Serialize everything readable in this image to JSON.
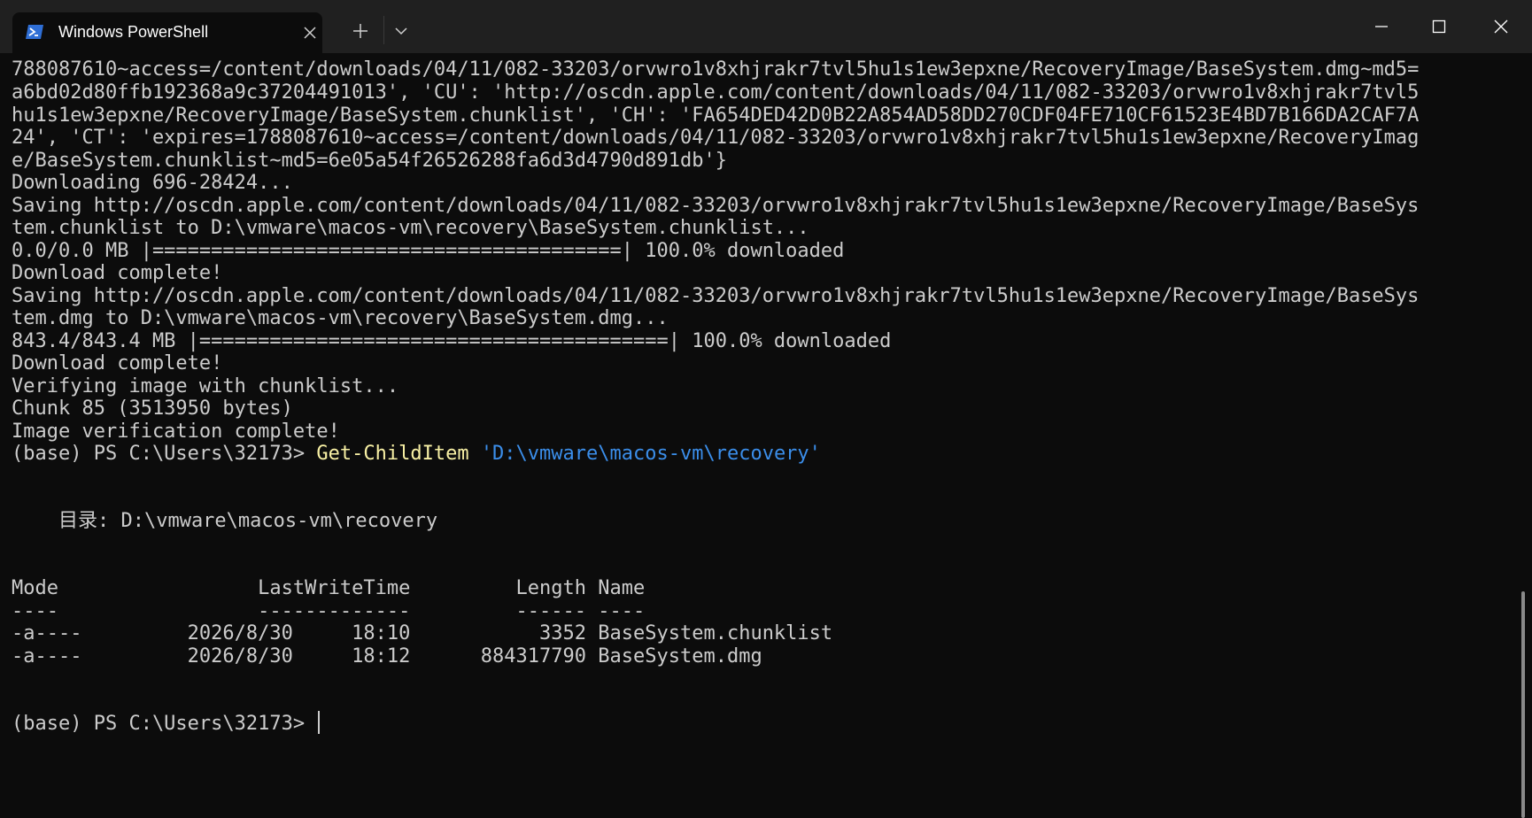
{
  "tab": {
    "title": "Windows PowerShell",
    "icon": "powershell-icon"
  },
  "terminal": {
    "wrapped_lines": [
      "788087610~access=/content/downloads/04/11/082-33203/orvwro1v8xhjrakr7tvl5hu1s1ew3epxne/RecoveryImage/BaseSystem.dmg~md5=",
      "a6bd02d80ffb192368a9c37204491013', 'CU': 'http://oscdn.apple.com/content/downloads/04/11/082-33203/orvwro1v8xhjrakr7tvl5",
      "hu1s1ew3epxne/RecoveryImage/BaseSystem.chunklist', 'CH': 'FA654DED42D0B22A854AD58DD270CDF04FE710CF61523E4BD7B166DA2CAF7A",
      "24', 'CT': 'expires=1788087610~access=/content/downloads/04/11/082-33203/orvwro1v8xhjrakr7tvl5hu1s1ew3epxne/RecoveryImag",
      "e/BaseSystem.chunklist~md5=6e05a54f26526288fa6d3d4790d891db'}",
      "Downloading 696-28424...",
      "Saving http://oscdn.apple.com/content/downloads/04/11/082-33203/orvwro1v8xhjrakr7tvl5hu1s1ew3epxne/RecoveryImage/BaseSys",
      "tem.chunklist to D:\\vmware\\macos-vm\\recovery\\BaseSystem.chunklist...",
      "0.0/0.0 MB |========================================| 100.0% downloaded",
      "Download complete!",
      "Saving http://oscdn.apple.com/content/downloads/04/11/082-33203/orvwro1v8xhjrakr7tvl5hu1s1ew3epxne/RecoveryImage/BaseSys",
      "tem.dmg to D:\\vmware\\macos-vm\\recovery\\BaseSystem.dmg...",
      "843.4/843.4 MB |========================================| 100.0% downloaded",
      "Download complete!",
      "Verifying image with chunklist...",
      "Chunk 85 (3513950 bytes)",
      "Image verification complete!"
    ],
    "prompt": "(base) PS C:\\Users\\32173> ",
    "command": "Get-ChildItem",
    "command_arg": "'D:\\vmware\\macos-vm\\recovery'",
    "directory_line": "    目录: D:\\vmware\\macos-vm\\recovery",
    "table_header": "Mode                 LastWriteTime         Length Name",
    "table_divider": "----                 -------------         ------ ----",
    "table_rows": [
      "-a----         2026/8/30     18:10           3352 BaseSystem.chunklist",
      "-a----         2026/8/30     18:12      884317790 BaseSystem.dmg"
    ],
    "final_prompt": "(base) PS C:\\Users\\32173> "
  }
}
